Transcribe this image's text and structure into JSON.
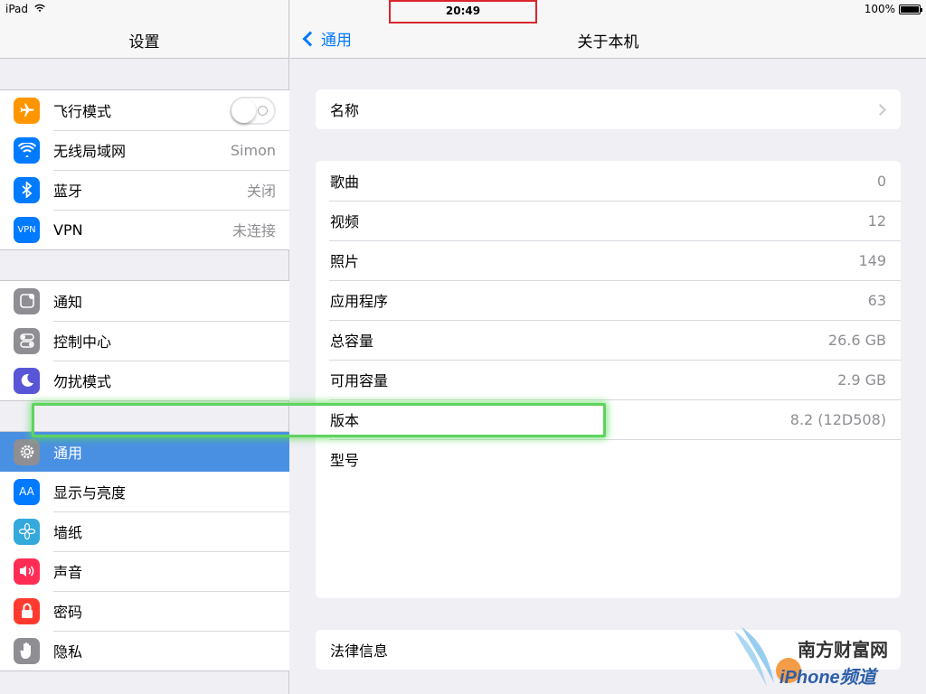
{
  "statusbar": {
    "device": "iPad",
    "time": "20:49",
    "battery_text": "100%",
    "battery_level": 1.0
  },
  "sidebar": {
    "title": "设置",
    "group1": [
      {
        "label": "飞行模式",
        "icon": "airplane-icon",
        "color": "#ff9500",
        "toggle": false
      },
      {
        "label": "无线局域网",
        "icon": "wifi-icon",
        "color": "#007aff",
        "value": "Simon"
      },
      {
        "label": "蓝牙",
        "icon": "bluetooth-icon",
        "color": "#007aff",
        "value": "关闭"
      },
      {
        "label": "VPN",
        "icon": "vpn-icon",
        "color": "#007aff",
        "value": "未连接",
        "icon_text": "VPN"
      }
    ],
    "group2": [
      {
        "label": "通知",
        "icon": "notifications-icon",
        "color": "#8e8e93"
      },
      {
        "label": "控制中心",
        "icon": "control-center-icon",
        "color": "#8e8e93"
      },
      {
        "label": "勿扰模式",
        "icon": "moon-icon",
        "color": "#5856d6"
      }
    ],
    "group3": [
      {
        "label": "通用",
        "icon": "gear-icon",
        "color": "#8e8e93",
        "selected": true
      },
      {
        "label": "显示与亮度",
        "icon": "display-icon",
        "color": "#007aff",
        "icon_text": "AA"
      },
      {
        "label": "墙纸",
        "icon": "wallpaper-icon",
        "color": "#34aadc"
      },
      {
        "label": "声音",
        "icon": "sound-icon",
        "color": "#ff2d55"
      },
      {
        "label": "密码",
        "icon": "lock-icon",
        "color": "#ff3b30"
      },
      {
        "label": "隐私",
        "icon": "hand-icon",
        "color": "#8e8e93"
      }
    ]
  },
  "detail": {
    "back_label": "通用",
    "title": "关于本机",
    "name_label": "名称",
    "rows": [
      {
        "label": "歌曲",
        "value": "0"
      },
      {
        "label": "视频",
        "value": "12"
      },
      {
        "label": "照片",
        "value": "149"
      },
      {
        "label": "应用程序",
        "value": "63"
      },
      {
        "label": "总容量",
        "value": "26.6 GB"
      },
      {
        "label": "可用容量",
        "value": "2.9 GB"
      },
      {
        "label": "版本",
        "value": "8.2 (12D508)"
      },
      {
        "label": "型号",
        "value": ""
      }
    ],
    "legal_label": "法律信息"
  },
  "colors": {
    "accent": "#007aff",
    "selected_row": "#4a90e2",
    "highlight_box": "#5fd35f",
    "time_box": "#d9262c"
  },
  "watermark": {
    "line1": "南方财富网",
    "line2": "iPhone频道"
  }
}
